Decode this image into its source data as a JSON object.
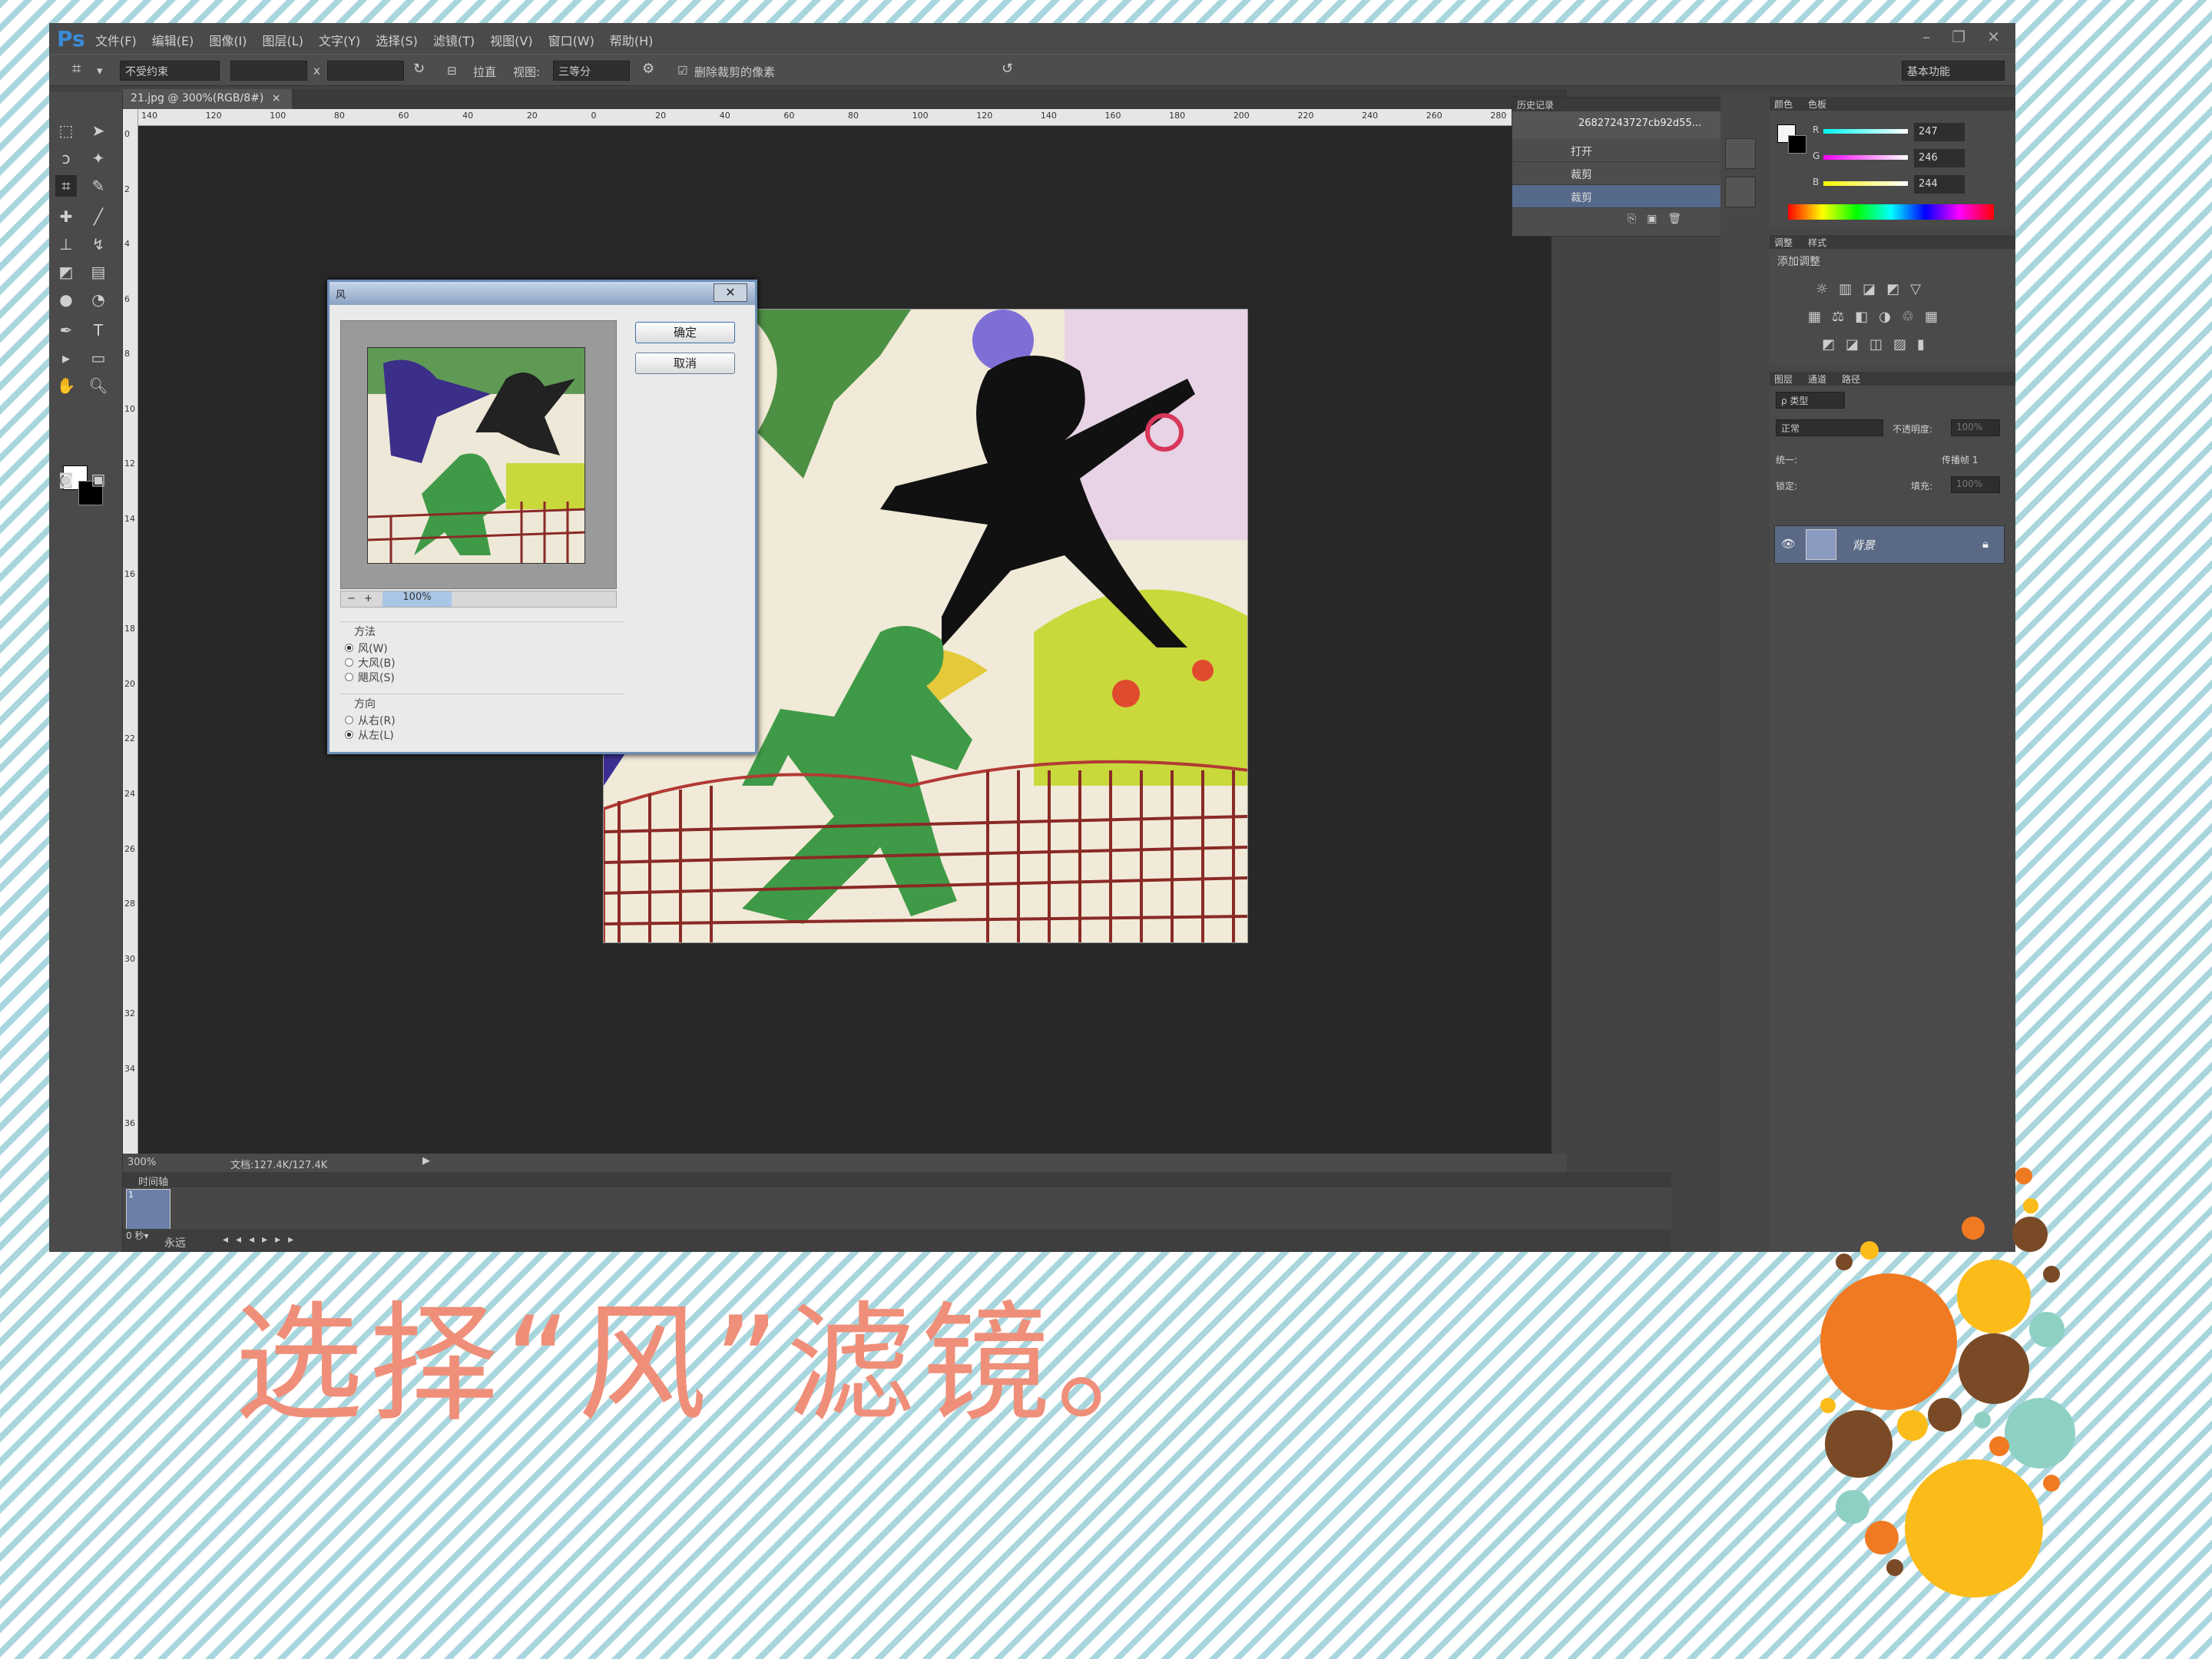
{
  "app": {
    "logo": "Ps"
  },
  "menu": [
    "文件(F)",
    "编辑(E)",
    "图像(I)",
    "图层(L)",
    "文字(Y)",
    "选择(S)",
    "滤镜(T)",
    "视图(V)",
    "窗口(W)",
    "帮助(H)"
  ],
  "window_controls": {
    "minimize": "–",
    "restore": "❐",
    "close": "✕"
  },
  "options_bar": {
    "ratio_select": "不受约束",
    "x_sep": "x",
    "straighten_label": "拉直",
    "view_label": "视图:",
    "view_select": "三等分",
    "delete_cropped_label": "删除裁剪的像素",
    "workspace_select": "基本功能"
  },
  "document": {
    "tab_label": "21.jpg @ 300%(RGB/8#)",
    "tab_close": "×"
  },
  "ruler_h_labels": [
    "140",
    "120",
    "100",
    "80",
    "60",
    "40",
    "20",
    "0",
    "20",
    "40",
    "60",
    "80",
    "100",
    "120",
    "140",
    "160",
    "180",
    "200",
    "220",
    "240",
    "260",
    "280"
  ],
  "ruler_v_labels": [
    "0",
    "2",
    "4",
    "6",
    "8",
    "10",
    "12",
    "14",
    "16",
    "18",
    "20",
    "22",
    "24",
    "26",
    "28",
    "30",
    "32",
    "34",
    "36"
  ],
  "status": {
    "zoom": "300%",
    "doc_size": "文档:127.4K/127.4K"
  },
  "timeline": {
    "title": "时间轴",
    "frame_label": "1",
    "frame_time": "0 秒▾",
    "loop_select": "永远"
  },
  "dialog": {
    "title_icon": "风",
    "close": "✕",
    "ok": "确定",
    "cancel": "取消",
    "zoom_pct": "100%",
    "zoom_minus": "−",
    "zoom_plus": "+",
    "method_title": "方法",
    "methods": [
      {
        "label": "风(W)",
        "selected": true
      },
      {
        "label": "大风(B)",
        "selected": false
      },
      {
        "label": "飓风(S)",
        "selected": false
      }
    ],
    "direction_title": "方向",
    "directions": [
      {
        "label": "从右(R)",
        "selected": false
      },
      {
        "label": "从左(L)",
        "selected": true
      }
    ]
  },
  "history_panel": {
    "tabs": [
      "历史记录"
    ],
    "snapshot_label": "26827243727cb92d55...",
    "items": [
      "打开",
      "裁剪",
      "裁剪"
    ]
  },
  "color_panel": {
    "tabs": [
      "颜色",
      "色板"
    ],
    "channels": [
      {
        "label": "R",
        "value": "247"
      },
      {
        "label": "G",
        "value": "246"
      },
      {
        "label": "B",
        "value": "244"
      }
    ]
  },
  "adjustments_panel": {
    "tabs": [
      "调整",
      "样式"
    ],
    "title": "添加调整"
  },
  "layers_panel": {
    "tabs": [
      "图层",
      "通道",
      "路径"
    ],
    "kind_select": "ρ 类型",
    "blend_select": "正常",
    "opacity_label": "不透明度:",
    "opacity_value": "100%",
    "unify_label": "统一:",
    "propagate_label": "传播帧 1",
    "lock_label": "锁定:",
    "fill_label": "填充:",
    "fill_value": "100%",
    "layer_name": "背景"
  },
  "caption": "选择“风”滤镜。",
  "colors": {
    "caption": "#ef8f7a",
    "ps_blue": "#3a8bd9",
    "stripe_blue": "#a9d6de",
    "dot_orange": "#f07a22",
    "dot_yellow": "#fbbc1a",
    "dot_brown": "#7a4a26",
    "dot_teal": "#8fd0c4"
  }
}
